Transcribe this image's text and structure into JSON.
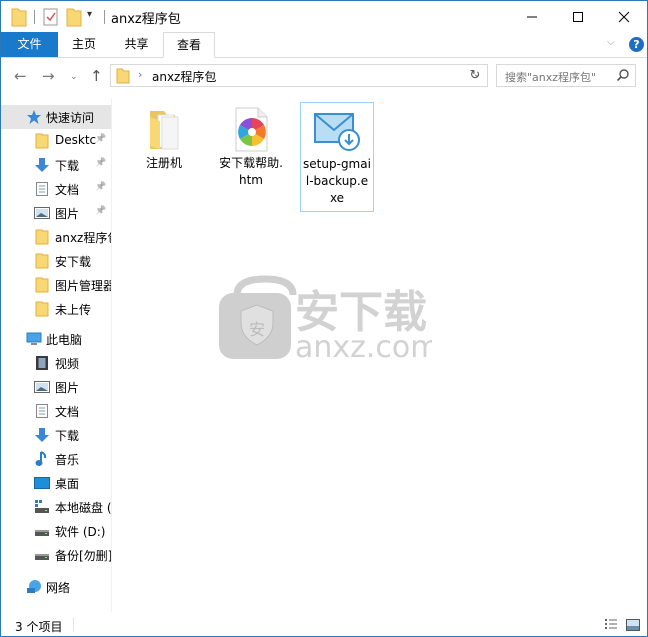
{
  "window": {
    "title": "anxz程序包",
    "controls": {
      "minimize": "minimize",
      "maximize": "maximize",
      "close": "close"
    }
  },
  "ribbon": {
    "tabs": [
      {
        "label": "文件",
        "active": true
      },
      {
        "label": "主页"
      },
      {
        "label": "共享"
      },
      {
        "label": "查看"
      }
    ],
    "help_label": "?"
  },
  "address": {
    "path": [
      "anxz程序包"
    ],
    "search_placeholder": "搜索\"anxz程序包\""
  },
  "sidebar": {
    "items": [
      {
        "label": "快速访问",
        "icon": "star-icon",
        "level": 0,
        "selected": true
      },
      {
        "label": "Desktc",
        "icon": "folder-icon",
        "level": 1,
        "pinned": true
      },
      {
        "label": "下载",
        "icon": "download-arrow-icon",
        "level": 1,
        "pinned": true
      },
      {
        "label": "文档",
        "icon": "document-icon",
        "level": 1,
        "pinned": true
      },
      {
        "label": "图片",
        "icon": "picture-icon",
        "level": 1,
        "pinned": true
      },
      {
        "label": "anxz程序包",
        "icon": "folder-icon",
        "level": 1
      },
      {
        "label": "安下载",
        "icon": "folder-icon",
        "level": 1
      },
      {
        "label": "图片管理器",
        "icon": "folder-icon",
        "level": 1
      },
      {
        "label": "未上传",
        "icon": "folder-icon",
        "level": 1
      },
      {
        "label": "此电脑",
        "icon": "computer-icon",
        "level": 0
      },
      {
        "label": "视频",
        "icon": "video-icon",
        "level": 1
      },
      {
        "label": "图片",
        "icon": "picture-icon",
        "level": 1
      },
      {
        "label": "文档",
        "icon": "document-icon",
        "level": 1
      },
      {
        "label": "下载",
        "icon": "download-arrow-icon",
        "level": 1
      },
      {
        "label": "音乐",
        "icon": "music-note-icon",
        "level": 1
      },
      {
        "label": "桌面",
        "icon": "desktop-icon",
        "level": 1
      },
      {
        "label": "本地磁盘 (C:)",
        "icon": "system-drive-icon",
        "level": 1
      },
      {
        "label": "软件 (D:)",
        "icon": "drive-icon",
        "level": 1
      },
      {
        "label": "备份[勿删] (E:)",
        "icon": "drive-icon",
        "level": 1
      },
      {
        "label": "网络",
        "icon": "network-icon",
        "level": 0
      }
    ]
  },
  "files": [
    {
      "name": "注册机",
      "type": "folder",
      "selected": false
    },
    {
      "name": "安下载帮助.htm",
      "type": "html",
      "selected": false
    },
    {
      "name": "setup-gmail-backup.exe",
      "type": "exe",
      "selected": true
    }
  ],
  "watermark": {
    "brand": "安下载",
    "domain": "anxz.com"
  },
  "status": {
    "item_count": "3 个项目"
  },
  "colors": {
    "accent": "#1979ca",
    "selection_border": "#99d1ff",
    "sidebar_selected": "#e5e5e5"
  }
}
